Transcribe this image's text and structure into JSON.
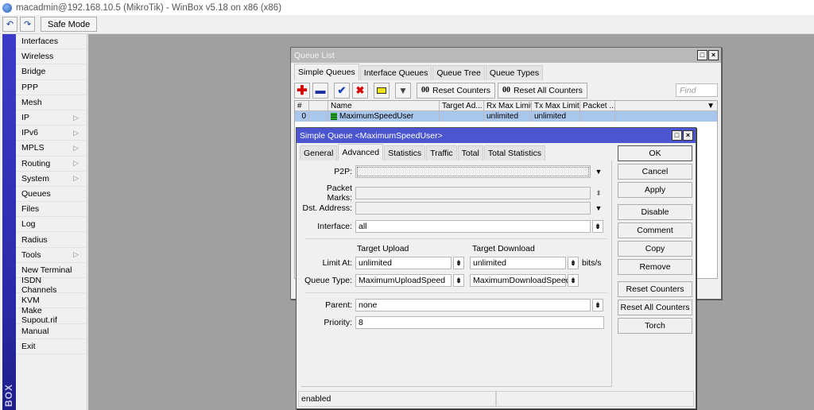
{
  "window": {
    "title": "macadmin@192.168.10.5 (MikroTik) - WinBox v5.18 on x86 (x86)"
  },
  "toolbar": {
    "undo": "↶",
    "redo": "↷",
    "safe_mode": "Safe Mode"
  },
  "sidebar": {
    "brand": "BOX",
    "items": [
      {
        "label": "Interfaces",
        "submenu": false
      },
      {
        "label": "Wireless",
        "submenu": false
      },
      {
        "label": "Bridge",
        "submenu": false
      },
      {
        "label": "PPP",
        "submenu": false
      },
      {
        "label": "Mesh",
        "submenu": false
      },
      {
        "label": "IP",
        "submenu": true
      },
      {
        "label": "IPv6",
        "submenu": true
      },
      {
        "label": "MPLS",
        "submenu": true
      },
      {
        "label": "Routing",
        "submenu": true
      },
      {
        "label": "System",
        "submenu": true
      },
      {
        "label": "Queues",
        "submenu": false
      },
      {
        "label": "Files",
        "submenu": false
      },
      {
        "label": "Log",
        "submenu": false
      },
      {
        "label": "Radius",
        "submenu": false
      },
      {
        "label": "Tools",
        "submenu": true
      },
      {
        "label": "New Terminal",
        "submenu": false
      },
      {
        "label": "ISDN Channels",
        "submenu": false
      },
      {
        "label": "KVM",
        "submenu": false
      },
      {
        "label": "Make Supout.rif",
        "submenu": false
      },
      {
        "label": "Manual",
        "submenu": false
      },
      {
        "label": "Exit",
        "submenu": false
      }
    ]
  },
  "queue_list": {
    "title": "Queue List",
    "tabs": [
      "Simple Queues",
      "Interface Queues",
      "Queue Tree",
      "Queue Types"
    ],
    "active_tab": 0,
    "buttons": {
      "reset_counters": "Reset Counters",
      "reset_all_counters": "Reset All Counters",
      "counter_glyph": "00"
    },
    "find_placeholder": "Find",
    "columns": [
      "#",
      "",
      "Name",
      "Target Ad...",
      "Rx Max Limit",
      "Tx Max Limit",
      "Packet ..."
    ],
    "rows": [
      {
        "num": "0",
        "flag": "",
        "name": "MaximumSpeedUser",
        "target": "",
        "rx": "unlimited",
        "tx": "unlimited",
        "packet": ""
      }
    ]
  },
  "simple_queue": {
    "title": "Simple Queue <MaximumSpeedUser>",
    "tabs": [
      "General",
      "Advanced",
      "Statistics",
      "Traffic",
      "Total",
      "Total Statistics"
    ],
    "active_tab": 1,
    "fields": {
      "p2p": {
        "label": "P2P:",
        "value": ""
      },
      "packet_marks": {
        "label": "Packet Marks:",
        "value": ""
      },
      "dst_address": {
        "label": "Dst. Address:",
        "value": ""
      },
      "interface": {
        "label": "Interface:",
        "value": "all"
      },
      "target_upload_header": "Target Upload",
      "target_download_header": "Target Download",
      "limit_at": {
        "label": "Limit At:",
        "upload": "unlimited",
        "download": "unlimited",
        "unit": "bits/s"
      },
      "queue_type": {
        "label": "Queue Type:",
        "upload": "MaximumUploadSpeed",
        "download": "MaximumDownloadSpeed"
      },
      "parent": {
        "label": "Parent:",
        "value": "none"
      },
      "priority": {
        "label": "Priority:",
        "value": "8"
      }
    },
    "buttons": [
      "OK",
      "Cancel",
      "Apply",
      "Disable",
      "Comment",
      "Copy",
      "Remove",
      "Reset Counters",
      "Reset All Counters",
      "Torch"
    ],
    "status": "enabled"
  }
}
